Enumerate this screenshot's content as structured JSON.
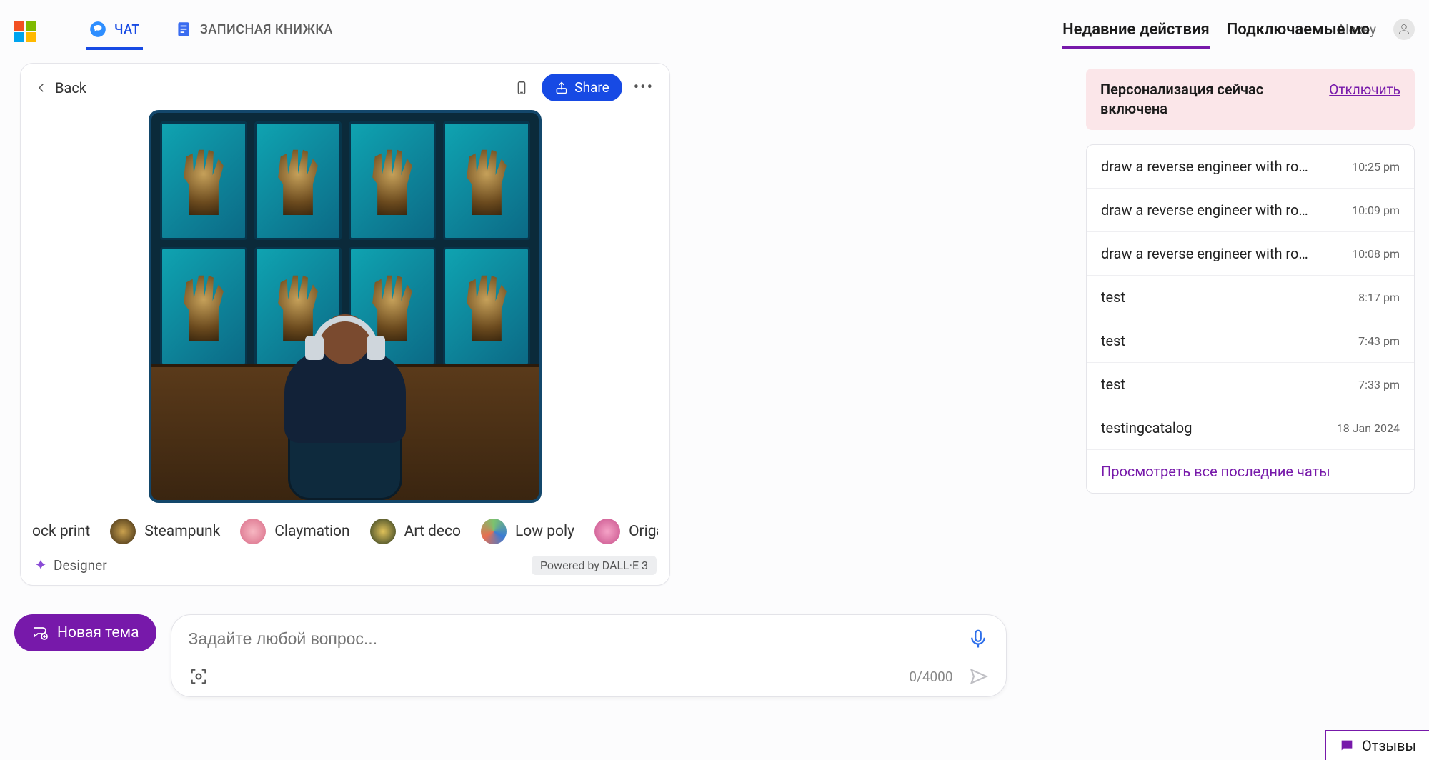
{
  "tabs": {
    "chat": "ЧАТ",
    "notebook": "ЗАПИСНАЯ КНИЖКА"
  },
  "rightNav": {
    "recent": "Недавние действия",
    "plugins": "Подключаемые мо",
    "user": "Alexey"
  },
  "card": {
    "back": "Back",
    "share": "Share",
    "styles": {
      "partial": "ock print",
      "s1": "Steampunk",
      "s2": "Claymation",
      "s3": "Art deco",
      "s4": "Low poly",
      "s5": "Origami"
    },
    "designer": "Designer",
    "powered": "Powered by DALL·E 3"
  },
  "composer": {
    "newTopic": "Новая тема",
    "placeholder": "Задайте любой вопрос...",
    "counter": "0/4000"
  },
  "banner": {
    "text": "Персонализация сейчас включена",
    "off": "Отключить"
  },
  "recent": {
    "items": [
      {
        "title": "draw a reverse engineer with robot meta",
        "time": "10:25 pm"
      },
      {
        "title": "draw a reverse engineer with robot meta",
        "time": "10:09 pm"
      },
      {
        "title": "draw a reverse engineer with robot meta",
        "time": "10:08 pm"
      },
      {
        "title": "test",
        "time": "8:17 pm"
      },
      {
        "title": "test",
        "time": "7:43 pm"
      },
      {
        "title": "test",
        "time": "7:33 pm"
      },
      {
        "title": "testingcatalog",
        "time": "18 Jan 2024"
      }
    ],
    "viewAll": "Просмотреть все последние чаты"
  },
  "feedback": "Отзывы"
}
